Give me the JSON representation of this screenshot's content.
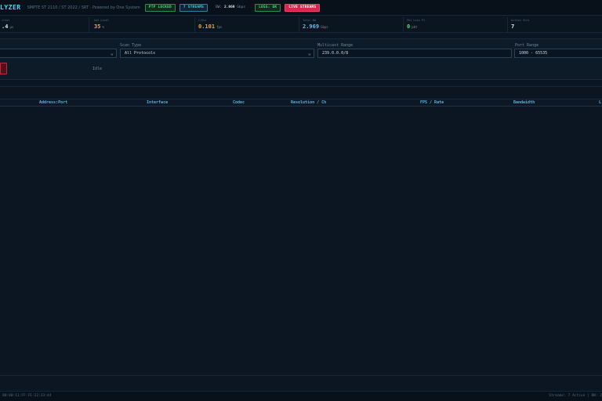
{
  "header": {
    "brand": "LYZER",
    "subtitle": "SMPTE ST 2110 / ST 2022 / SRT · Powered by One System",
    "ptp_badge": "PTP LOCKED",
    "streams_badge": "7 STREAMS",
    "bw_label": "BW:",
    "bw_value": "2.969",
    "bw_unit": "Gbps",
    "loss_badge": "LOSS: OK",
    "live_badge": "LIVE STREAMS"
  },
  "stats": [
    {
      "label": "itter",
      "value": ".4",
      "unit": "µs",
      "color": "#d4e6f1"
    },
    {
      "label": "QoS Level",
      "value": "35",
      "unit": "%",
      "color": "#f0a23c"
    },
    {
      "label": "C/Ovr",
      "value": "0.101",
      "unit": "fps",
      "color": "#f0a23c"
    },
    {
      "label": "Total BW",
      "value": "2.969",
      "unit": "Gbps",
      "color": "#47c8f0"
    },
    {
      "label": "Pkt Loss P1",
      "value": "0",
      "unit": "pkt",
      "color": "#42e07a"
    },
    {
      "label": "Active Stre",
      "value": "7",
      "unit": "",
      "color": "#d4e6f1"
    }
  ],
  "scan": {
    "scan_type_label": "Scan Type",
    "scan_type_value": "All Protocols",
    "multicast_label": "Multicast Range",
    "multicast_value": "239.0.0.0/8",
    "port_label": "Port Range",
    "port_value": "1000 - 65535",
    "status": "Idle"
  },
  "table": {
    "columns": [
      "Address:Port",
      "Interface",
      "Codec",
      "Resolution / Ch",
      "FPS / Rate",
      "Bandwidth",
      "L"
    ]
  },
  "footer": {
    "left": "00:00:11:FF:FE:22:33:44",
    "right": "Streams: 7 Active | BW: 2"
  }
}
